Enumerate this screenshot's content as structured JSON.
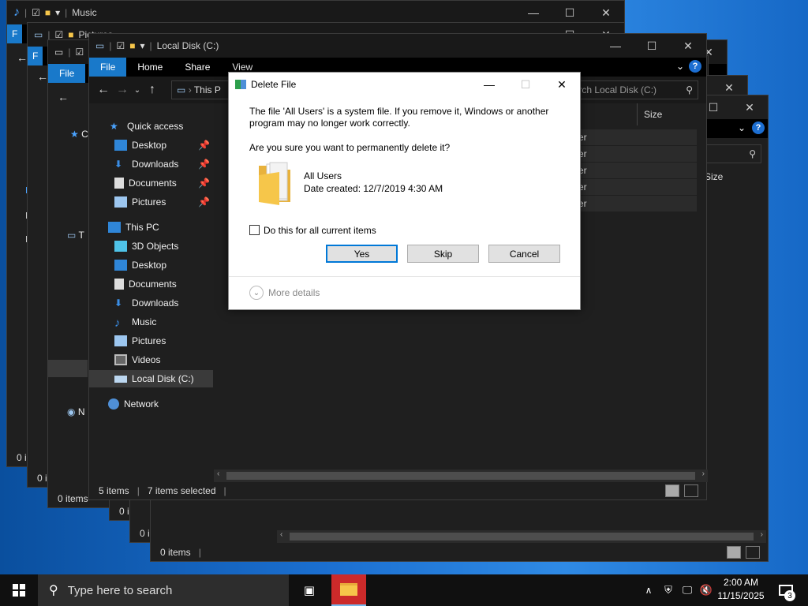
{
  "windows": {
    "music": {
      "title": "Music",
      "file_tab": "F",
      "status": "0 i"
    },
    "pictures": {
      "title": "Pictures",
      "file_tab": "F",
      "status": "0 i"
    },
    "third": {
      "file_tab": "File",
      "status": "0 items",
      "nav_letters": [
        "C",
        "T",
        "N"
      ]
    },
    "back4": {
      "status": "0 i"
    },
    "back5": {
      "status": "0 i"
    },
    "rear": {
      "status": "0 items",
      "col_size": "Size"
    },
    "local_disk": {
      "title": "Local Disk (C:)",
      "ribbon": [
        "File",
        "Home",
        "Share",
        "View"
      ],
      "address": "This P",
      "search_placeholder": "Local Disk (C:)",
      "column_size": "Size",
      "row_fragments": [
        "er",
        "er",
        "er",
        "er",
        "er"
      ],
      "status_items": "5 items",
      "status_selected": "7 items selected",
      "nav": {
        "quick_access": "Quick access",
        "qa_items": [
          "Desktop",
          "Downloads",
          "Documents",
          "Pictures"
        ],
        "this_pc": "This PC",
        "pc_items": [
          "3D Objects",
          "Desktop",
          "Documents",
          "Downloads",
          "Music",
          "Pictures",
          "Videos",
          "Local Disk (C:)"
        ],
        "network": "Network"
      }
    }
  },
  "dialog": {
    "title": "Delete File",
    "message": "The file 'All Users' is a system file. If you remove it, Windows or another program may no longer work correctly.",
    "question": "Are you sure you want to permanently delete it?",
    "item_name": "All Users",
    "item_date": "Date created: 12/7/2019 4:30 AM",
    "checkbox_label": "Do this for all current items",
    "yes": "Yes",
    "skip": "Skip",
    "cancel": "Cancel",
    "more_details": "More details"
  },
  "taskbar": {
    "search_placeholder": "Type here to search",
    "time": "2:00 AM",
    "date": "11/15/2025",
    "notification_count": "3"
  },
  "colors": {
    "accent": "#1979ca",
    "folder": "#f6c64a"
  }
}
